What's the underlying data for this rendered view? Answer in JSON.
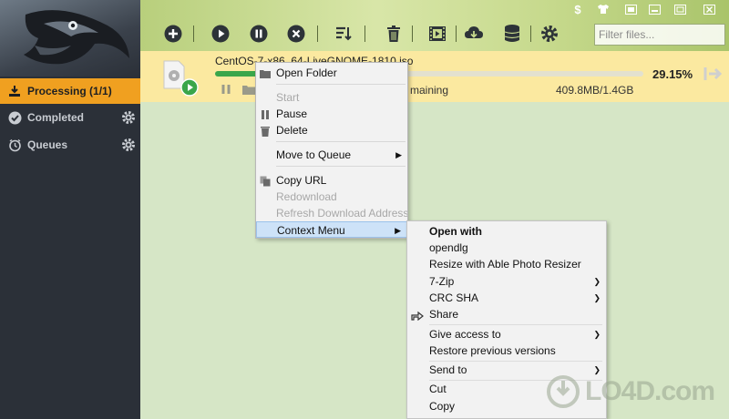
{
  "toolbar": {
    "filter_placeholder": "Filter files..."
  },
  "sidebar": {
    "items": [
      {
        "label": "Processing (1/1)"
      },
      {
        "label": "Completed"
      },
      {
        "label": "Queues"
      }
    ]
  },
  "download": {
    "filename": "CentOS-7-x86_64-LiveGNOME-1810.iso",
    "progress": 0.2915,
    "percent_text": "29.15%",
    "size_text": "409.8MB/1.4GB",
    "remaining_text": "maining"
  },
  "menu": {
    "items": [
      {
        "label": "Open Folder"
      },
      {
        "label": "Start"
      },
      {
        "label": "Pause"
      },
      {
        "label": "Delete"
      },
      {
        "label": "Move to Queue"
      },
      {
        "label": "Copy URL"
      },
      {
        "label": "Redownload"
      },
      {
        "label": "Refresh Download Address"
      },
      {
        "label": "Context Menu"
      }
    ]
  },
  "context_menu": {
    "items": [
      {
        "label": "Open with"
      },
      {
        "label": "opendlg"
      },
      {
        "label": "Resize with Able Photo Resizer"
      },
      {
        "label": "7-Zip"
      },
      {
        "label": "CRC SHA"
      },
      {
        "label": "Share"
      },
      {
        "label": "Give access to"
      },
      {
        "label": "Restore previous versions"
      },
      {
        "label": "Send to"
      },
      {
        "label": "Cut"
      },
      {
        "label": "Copy"
      }
    ]
  },
  "watermark": {
    "text": "LO4D.com"
  },
  "colors": {
    "sidebar_bg": "#2b3038",
    "active_item": "#f0a020",
    "progress": "#3aa64a",
    "download_row": "#fbe9a0",
    "content_bg": "#d6e6c6"
  }
}
